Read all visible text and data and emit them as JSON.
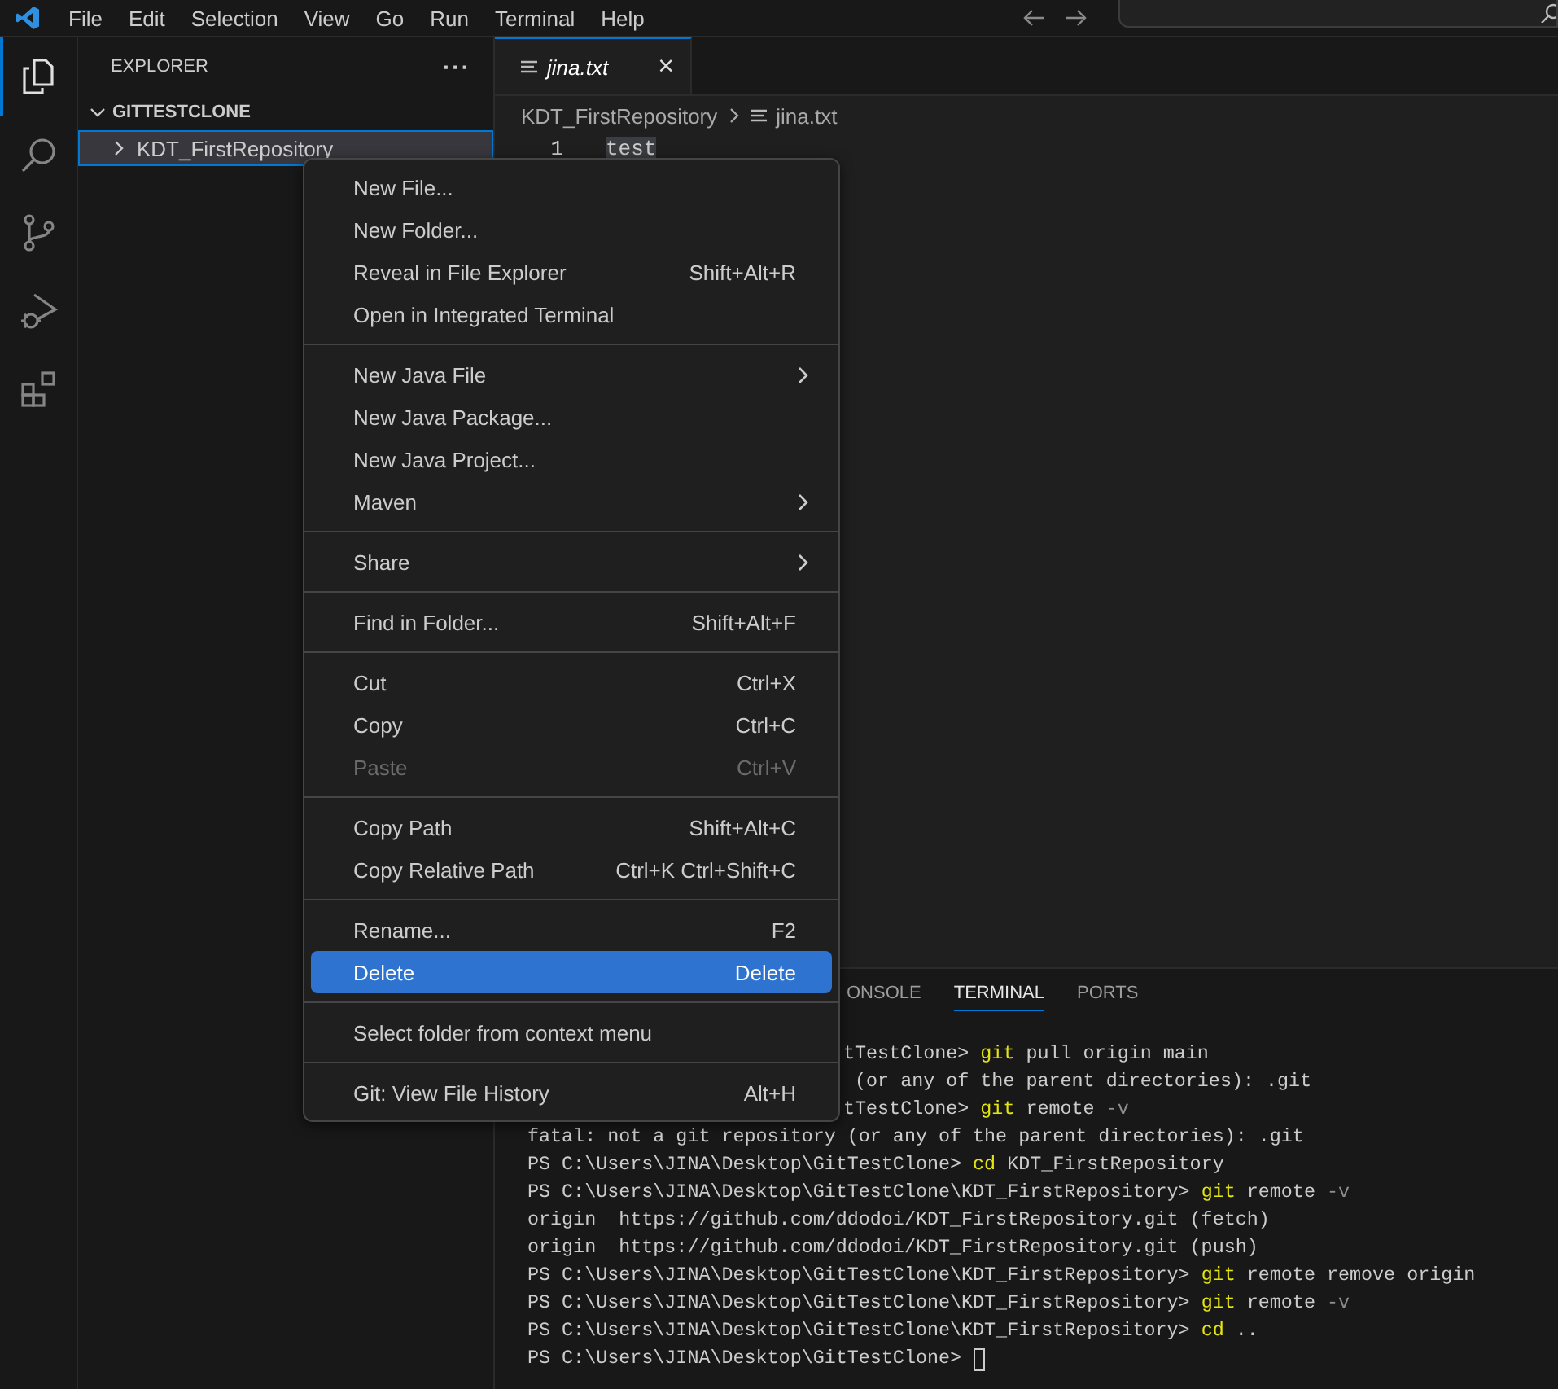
{
  "menubar": [
    "File",
    "Edit",
    "Selection",
    "View",
    "Go",
    "Run",
    "Terminal",
    "Help"
  ],
  "activity_bar": [
    {
      "kind": "explorer",
      "selected": true
    },
    {
      "kind": "search",
      "selected": false
    },
    {
      "kind": "source-control",
      "selected": false
    },
    {
      "kind": "run-debug",
      "selected": false
    },
    {
      "kind": "extensions",
      "selected": false
    }
  ],
  "sidebar": {
    "title": "EXPLORER",
    "more": "···",
    "section": {
      "label": "GITTESTCLONE",
      "expanded": true
    },
    "items": [
      {
        "label": "KDT_FirstRepository",
        "expanded": false,
        "selected": true
      }
    ]
  },
  "editor": {
    "tabs": [
      {
        "label": "jina.txt",
        "selected": true,
        "close": "×"
      }
    ],
    "breadcrumbs": [
      "KDT_FirstRepository",
      "jina.txt"
    ],
    "lines": [
      {
        "number": "1",
        "text": "test"
      }
    ]
  },
  "panel": {
    "tabs": [
      {
        "label": "ONSOLE",
        "selected": false
      },
      {
        "label": "TERMINAL",
        "selected": true
      },
      {
        "label": "PORTS",
        "selected": false
      }
    ],
    "terminal": [
      {
        "kind": "clipped",
        "segments": [
          {
            "kind": "prompt",
            "text": "tTestClone> "
          },
          {
            "kind": "cmd",
            "text": "git"
          },
          {
            "kind": "arg",
            "text": " pull origin main"
          }
        ]
      },
      {
        "kind": "clipped",
        "segments": [
          {
            "kind": "prompt",
            "text": " (or any of the parent directories): .git"
          }
        ]
      },
      {
        "kind": "clipped",
        "segments": [
          {
            "kind": "prompt",
            "text": "tTestClone> "
          },
          {
            "kind": "cmd",
            "text": "git"
          },
          {
            "kind": "arg",
            "text": " remote "
          },
          {
            "kind": "flag",
            "text": "-v"
          }
        ]
      },
      {
        "kind": "full",
        "segments": [
          {
            "kind": "prompt",
            "text": "fatal: not a git repository (or any of the parent directories): .git"
          }
        ]
      },
      {
        "kind": "full",
        "segments": [
          {
            "kind": "prompt",
            "text": "PS C:\\Users\\JINA\\Desktop\\GitTestClone> "
          },
          {
            "kind": "cmd",
            "text": "cd"
          },
          {
            "kind": "arg",
            "text": " KDT_FirstRepository"
          }
        ]
      },
      {
        "kind": "full",
        "segments": [
          {
            "kind": "prompt",
            "text": "PS C:\\Users\\JINA\\Desktop\\GitTestClone\\KDT_FirstRepository> "
          },
          {
            "kind": "cmd",
            "text": "git"
          },
          {
            "kind": "arg",
            "text": " remote "
          },
          {
            "kind": "flag",
            "text": "-v"
          }
        ]
      },
      {
        "kind": "full",
        "segments": [
          {
            "kind": "prompt",
            "text": "origin  https://github.com/ddodoi/KDT_FirstRepository.git (fetch)"
          }
        ]
      },
      {
        "kind": "full",
        "segments": [
          {
            "kind": "prompt",
            "text": "origin  https://github.com/ddodoi/KDT_FirstRepository.git (push)"
          }
        ]
      },
      {
        "kind": "full",
        "segments": [
          {
            "kind": "prompt",
            "text": "PS C:\\Users\\JINA\\Desktop\\GitTestClone\\KDT_FirstRepository> "
          },
          {
            "kind": "cmd",
            "text": "git"
          },
          {
            "kind": "arg",
            "text": " remote remove origin"
          }
        ]
      },
      {
        "kind": "full",
        "segments": [
          {
            "kind": "prompt",
            "text": "PS C:\\Users\\JINA\\Desktop\\GitTestClone\\KDT_FirstRepository> "
          },
          {
            "kind": "cmd",
            "text": "git"
          },
          {
            "kind": "arg",
            "text": " remote "
          },
          {
            "kind": "flag",
            "text": "-v"
          }
        ]
      },
      {
        "kind": "full",
        "segments": [
          {
            "kind": "prompt",
            "text": "PS C:\\Users\\JINA\\Desktop\\GitTestClone\\KDT_FirstRepository> "
          },
          {
            "kind": "cmd",
            "text": "cd"
          },
          {
            "kind": "arg",
            "text": " .."
          }
        ]
      },
      {
        "kind": "cursor",
        "segments": [
          {
            "kind": "prompt",
            "text": "PS C:\\Users\\JINA\\Desktop\\GitTestClone> "
          }
        ]
      }
    ]
  },
  "context_menu": [
    {
      "kind": "item",
      "label": "New File...",
      "selected": false,
      "disabled": false
    },
    {
      "kind": "item",
      "label": "New Folder...",
      "selected": false,
      "disabled": false
    },
    {
      "kind": "item",
      "label": "Reveal in File Explorer",
      "shortcut": "Shift+Alt+R",
      "selected": false,
      "disabled": false
    },
    {
      "kind": "item",
      "label": "Open in Integrated Terminal",
      "selected": false,
      "disabled": false
    },
    {
      "kind": "separator"
    },
    {
      "kind": "submenu",
      "label": "New Java File",
      "selected": false,
      "disabled": false
    },
    {
      "kind": "item",
      "label": "New Java Package...",
      "selected": false,
      "disabled": false
    },
    {
      "kind": "item",
      "label": "New Java Project...",
      "selected": false,
      "disabled": false
    },
    {
      "kind": "submenu",
      "label": "Maven",
      "selected": false,
      "disabled": false
    },
    {
      "kind": "separator"
    },
    {
      "kind": "submenu",
      "label": "Share",
      "selected": false,
      "disabled": false
    },
    {
      "kind": "separator"
    },
    {
      "kind": "item",
      "label": "Find in Folder...",
      "shortcut": "Shift+Alt+F",
      "selected": false,
      "disabled": false
    },
    {
      "kind": "separator"
    },
    {
      "kind": "item",
      "label": "Cut",
      "shortcut": "Ctrl+X",
      "selected": false,
      "disabled": false
    },
    {
      "kind": "item",
      "label": "Copy",
      "shortcut": "Ctrl+C",
      "selected": false,
      "disabled": false
    },
    {
      "kind": "item",
      "label": "Paste",
      "shortcut": "Ctrl+V",
      "selected": false,
      "disabled": true
    },
    {
      "kind": "separator"
    },
    {
      "kind": "item",
      "label": "Copy Path",
      "shortcut": "Shift+Alt+C",
      "selected": false,
      "disabled": false
    },
    {
      "kind": "item",
      "label": "Copy Relative Path",
      "shortcut": "Ctrl+K Ctrl+Shift+C",
      "selected": false,
      "disabled": false
    },
    {
      "kind": "separator"
    },
    {
      "kind": "item",
      "label": "Rename...",
      "shortcut": "F2",
      "selected": false,
      "disabled": false
    },
    {
      "kind": "item",
      "label": "Delete",
      "shortcut": "Delete",
      "selected": true,
      "disabled": false
    },
    {
      "kind": "separator"
    },
    {
      "kind": "item",
      "label": "Select folder from context menu",
      "selected": false,
      "disabled": false
    },
    {
      "kind": "separator"
    },
    {
      "kind": "item",
      "label": "Git: View File History",
      "shortcut": "Alt+H",
      "selected": false,
      "disabled": false
    }
  ]
}
